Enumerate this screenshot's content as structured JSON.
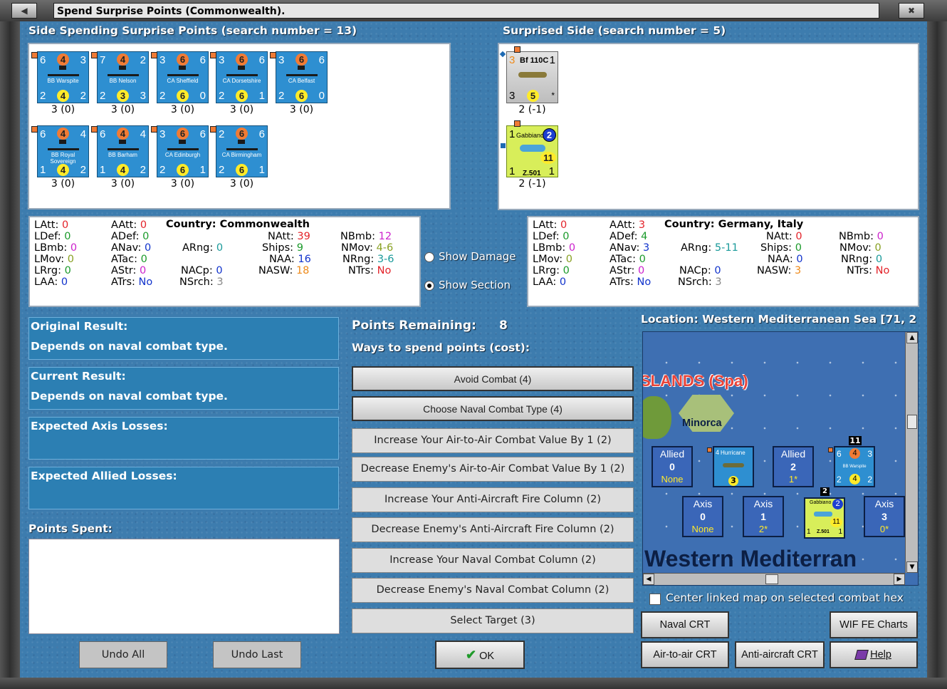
{
  "window": {
    "title": "Spend Surprise Points (Commonwealth)."
  },
  "spending_side": {
    "header": "Side Spending Surprise Points (search number = 13)",
    "units": [
      {
        "name": "BB Warspite",
        "tl": "6",
        "tc": "4",
        "tr": "3",
        "bl": "2",
        "bc": "4",
        "br": "2",
        "value": "3 (0)"
      },
      {
        "name": "BB Nelson",
        "tl": "7",
        "tc": "4",
        "tr": "2",
        "bl": "2",
        "bc": "3",
        "br": "3",
        "value": "3 (0)"
      },
      {
        "name": "CA Sheffield",
        "tl": "3",
        "tc": "6",
        "tr": "6",
        "bl": "2",
        "bc": "6",
        "br": "0",
        "value": "3 (0)"
      },
      {
        "name": "CA Dorsetshire",
        "tl": "3",
        "tc": "6",
        "tr": "6",
        "bl": "2",
        "bc": "6",
        "br": "1",
        "value": "3 (0)"
      },
      {
        "name": "CA Belfast",
        "tl": "3",
        "tc": "6",
        "tr": "6",
        "bl": "2",
        "bc": "6",
        "br": "0",
        "value": "3 (0)"
      },
      {
        "name": "BB Royal Sovereign",
        "tl": "6",
        "tc": "4",
        "tr": "4",
        "bl": "1",
        "bc": "4",
        "br": "2",
        "value": "3 (0)"
      },
      {
        "name": "BB Barham",
        "tl": "6",
        "tc": "4",
        "tr": "4",
        "bl": "1",
        "bc": "4",
        "br": "2",
        "value": "3 (0)"
      },
      {
        "name": "CA Edinburgh",
        "tl": "3",
        "tc": "6",
        "tr": "6",
        "bl": "2",
        "bc": "6",
        "br": "1",
        "value": "3 (0)"
      },
      {
        "name": "CA Birmingham",
        "tl": "2",
        "tc": "6",
        "tr": "6",
        "bl": "2",
        "bc": "6",
        "br": "1",
        "value": "3 (0)"
      }
    ],
    "stats": {
      "latt": "LAtt:",
      "latt_v": "0",
      "ldef": "LDef:",
      "ldef_v": "0",
      "lbmb": "LBmb:",
      "lbmb_v": "0",
      "lmov": "LMov:",
      "lmov_v": "0",
      "lrrg": "LRrg:",
      "lrrg_v": "0",
      "laa": "LAA:",
      "laa_v": "0",
      "aatt": "AAtt:",
      "aatt_v": "0",
      "adef": "ADef:",
      "adef_v": "0",
      "anav": "ANav:",
      "anav_v": "0",
      "atac": "ATac:",
      "atac_v": "0",
      "astr": "AStr:",
      "astr_v": "0",
      "atrs": "ATrs:",
      "atrs_v": "No",
      "country": "Country: Commonwealth",
      "arng": "ARng:",
      "arng_v": "0",
      "nacp": "NACp:",
      "nacp_v": "0",
      "nsrch": "NSrch:",
      "nsrch_v": "3",
      "natt": "NAtt:",
      "natt_v": "39",
      "ships": "Ships:",
      "ships_v": "9",
      "naa": "NAA:",
      "naa_v": "16",
      "nasw": "NASW:",
      "nasw_v": "18",
      "nbmb": "NBmb:",
      "nbmb_v": "12",
      "nmov": "NMov:",
      "nmov_v": "4-6",
      "nrng": "NRng:",
      "nrng_v": "3-6",
      "ntrs": "NTrs:",
      "ntrs_v": "No"
    }
  },
  "surprised_side": {
    "header": "Surprised Side (search number = 5)",
    "units": [
      {
        "name": "Bf 110C",
        "tl": "3",
        "tr": "1",
        "bl": "3",
        "bc": "5",
        "br": "*",
        "value": "2 (-1)"
      },
      {
        "name": "Gabbiano",
        "subname": "Z.501",
        "tl": "1",
        "tc": "2",
        "bl": "1",
        "bc": "11",
        "br": "1",
        "value": "2 (-1)"
      }
    ],
    "stats": {
      "latt": "LAtt:",
      "latt_v": "0",
      "ldef": "LDef:",
      "ldef_v": "0",
      "lbmb": "LBmb:",
      "lbmb_v": "0",
      "lmov": "LMov:",
      "lmov_v": "0",
      "lrrg": "LRrg:",
      "lrrg_v": "0",
      "laa": "LAA:",
      "laa_v": "0",
      "aatt": "AAtt:",
      "aatt_v": "3",
      "adef": "ADef:",
      "adef_v": "4",
      "anav": "ANav:",
      "anav_v": "3",
      "atac": "ATac:",
      "atac_v": "0",
      "astr": "AStr:",
      "astr_v": "0",
      "atrs": "ATrs:",
      "atrs_v": "No",
      "country": "Country: Germany, Italy",
      "arng": "ARng:",
      "arng_v": "5-11",
      "nacp": "NACp:",
      "nacp_v": "0",
      "nsrch": "NSrch:",
      "nsrch_v": "3",
      "natt": "NAtt:",
      "natt_v": "0",
      "ships": "Ships:",
      "ships_v": "0",
      "naa": "NAA:",
      "naa_v": "0",
      "nasw": "NASW:",
      "nasw_v": "3",
      "nbmb": "NBmb:",
      "nbmb_v": "0",
      "nmov": "NMov:",
      "nmov_v": "0",
      "nrng": "NRng:",
      "nrng_v": "0",
      "ntrs": "NTrs:",
      "ntrs_v": "No"
    }
  },
  "display": {
    "show_damage": "Show Damage",
    "show_section": "Show Section",
    "selected": "Show Section"
  },
  "results": {
    "original_label": "Original Result:",
    "original_value": "Depends on naval combat type.",
    "current_label": "Current Result:",
    "current_value": "Depends on naval combat type.",
    "axis_losses_label": "Expected Axis Losses:",
    "allied_losses_label": "Expected Allied Losses:",
    "points_spent_label": "Points Spent:"
  },
  "spending": {
    "points_remaining_label": "Points Remaining:",
    "points_remaining": "8",
    "ways_label": "Ways to spend points (cost):",
    "options": [
      "Avoid Combat (4)",
      "Choose Naval Combat Type (4)",
      "Increase Your Air-to-Air Combat Value By 1 (2)",
      "Decrease Enemy's Air-to-Air Combat Value By 1 (2)",
      "Increase Your Anti-Aircraft Fire Column (2)",
      "Decrease Enemy's Anti-Aircraft Fire Column (2)",
      "Increase Your Naval Combat Column (2)",
      "Decrease Enemy's Naval Combat Column (2)",
      "Select Target (3)"
    ]
  },
  "map": {
    "location": "Location: Western Mediterranean Sea [71, 2",
    "islands_label": "SLANDS (Spa)",
    "minorca": "Minorca",
    "sea_label": "Western Mediterran",
    "allied_boxes": [
      {
        "side": "Allied",
        "value": "0",
        "sub": "None"
      },
      {
        "side": "Allied",
        "value": "2",
        "sub": "1*"
      }
    ],
    "axis_boxes": [
      {
        "side": "Axis",
        "value": "0",
        "sub": "None"
      },
      {
        "side": "Axis",
        "value": "1",
        "sub": "2*"
      },
      {
        "side": "Axis",
        "value": "3",
        "sub": "0*"
      }
    ],
    "stack_11": "11",
    "stack_2": "2",
    "hurricane": "Hurricane",
    "hurricane_v": "4",
    "hurricane_c": "3",
    "warspite": {
      "name": "BB Warspite",
      "tl": "6",
      "tc": "4",
      "tr": "3",
      "bl": "2",
      "bc": "4",
      "br": "2"
    },
    "gabbiano": {
      "name": "Gabbiano",
      "sub": "Z.501",
      "tc": "2",
      "bc": "11",
      "bl": "1",
      "br": "1"
    },
    "center_checkbox": "Center linked map on selected combat hex"
  },
  "buttons": {
    "undo_all": "Undo All",
    "undo_last": "Undo Last",
    "ok": "OK",
    "naval_crt": "Naval CRT",
    "wif_fe_charts": "WIF FE Charts",
    "air_to_air_crt": "Air-to-air CRT",
    "anti_aircraft_crt": "Anti-aircraft CRT",
    "help": "Help"
  },
  "colors": {
    "background": "#3d7cae",
    "panel": "#2c7fb3",
    "counter_naval": "#2e8fd1",
    "counter_italian": "#d8ee5a"
  }
}
